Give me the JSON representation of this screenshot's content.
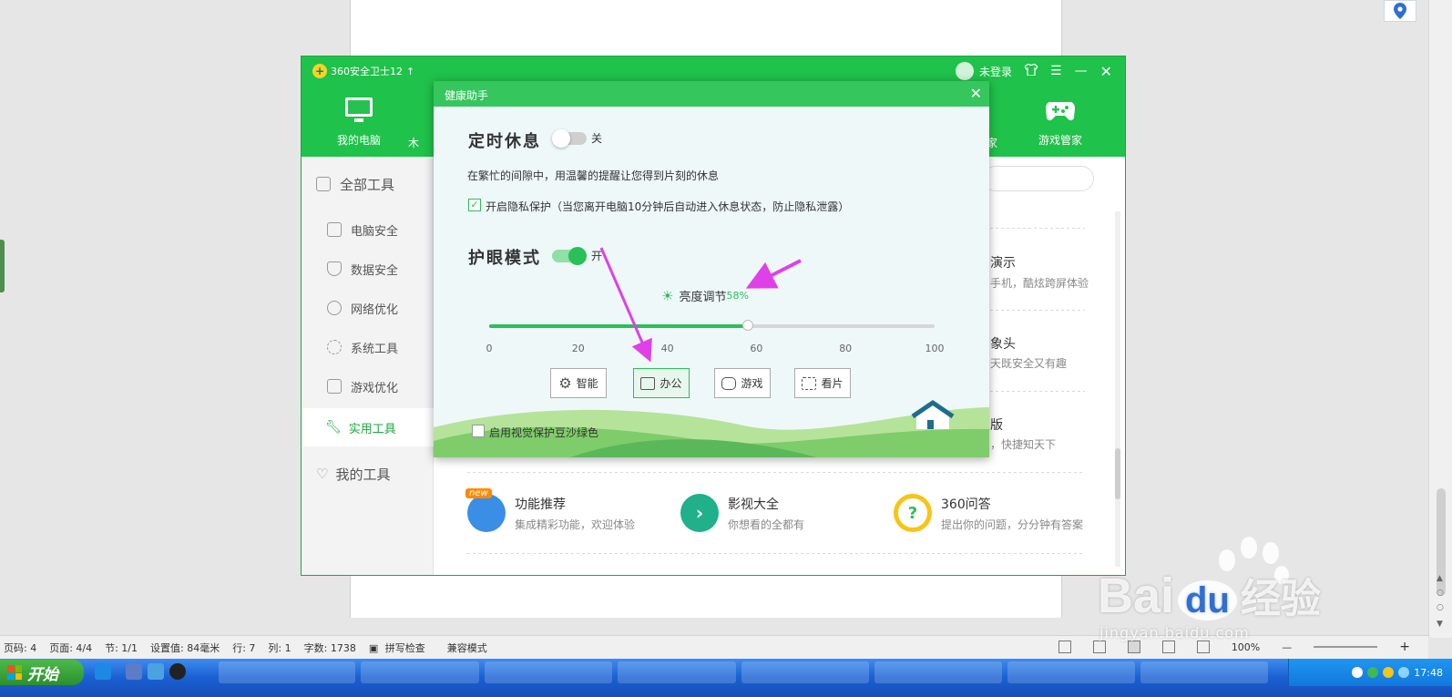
{
  "doc_status": {
    "page_code": "页码: 4",
    "pages": "页面: 4/4",
    "section": "节: 1/1",
    "setting": "设置值: 84毫米",
    "row": "行: 7",
    "col": "列: 1",
    "word_count": "字数: 1738",
    "spell_check": "拼写检查",
    "compat_mode": "兼容模式",
    "zoom": "100%"
  },
  "main_window": {
    "title": "360安全卫士12",
    "login": "未登录",
    "nav": [
      {
        "label": "我的电脑",
        "icon": "monitor-icon"
      },
      {
        "label": "木",
        "icon": "trojan-icon"
      },
      {
        "label": "家",
        "icon": "home-icon"
      },
      {
        "label": "游戏管家",
        "icon": "gamepad-icon"
      }
    ],
    "sidebar": {
      "all_tools": "全部工具",
      "items": [
        "电脑安全",
        "数据安全",
        "网络优化",
        "系统工具",
        "游戏优化",
        "实用工具"
      ],
      "my_tools": "我的工具",
      "active_index": 5
    },
    "partial_tools": [
      {
        "title": "演示",
        "desc": "手机，酷炫跨屏体验"
      },
      {
        "title": "象头",
        "desc": "天既安全又有趣"
      },
      {
        "title": "版",
        "desc": "，快捷知天下"
      }
    ],
    "tools": [
      {
        "title": "功能推荐",
        "desc": "集成精彩功能，欢迎体验",
        "badge": "new",
        "icon": "megaphone-icon",
        "color": "#3a8ee6"
      },
      {
        "title": "影视大全",
        "desc": "你想看的全都有",
        "icon": "play-icon",
        "color": "#20b08a"
      },
      {
        "title": "360问答",
        "desc": "提出你的问题，分分钟有答案",
        "icon": "question-icon",
        "color": "#f5c518"
      }
    ]
  },
  "dialog": {
    "title": "健康助手",
    "rest": {
      "title": "定时休息",
      "toggle_label": "关",
      "toggle_on": false,
      "desc": "在繁忙的间隙中，用温馨的提醒让您得到片刻的休息",
      "privacy_label": "开启隐私保护（当您离开电脑10分钟后自动进入休息状态，防止隐私泄露）",
      "privacy_checked": true
    },
    "eye": {
      "title": "护眼模式",
      "toggle_label": "开",
      "toggle_on": true,
      "brightness_label": "亮度调节",
      "brightness_value": "58%",
      "brightness_fraction": 0.58,
      "ticks": [
        "0",
        "20",
        "40",
        "60",
        "80",
        "100"
      ],
      "modes": [
        {
          "label": "智能",
          "icon": "gear-icon"
        },
        {
          "label": "办公",
          "icon": "monitor-icon"
        },
        {
          "label": "游戏",
          "icon": "gamepad-icon"
        },
        {
          "label": "看片",
          "icon": "film-icon"
        }
      ],
      "selected_mode": 1,
      "green_label": "启用视觉保护豆沙绿色",
      "green_checked": false
    }
  },
  "taskbar": {
    "start": "开始",
    "clock": "17:48"
  },
  "watermark": {
    "brand": "Bai",
    "brand_cn": "经验",
    "url": "jingyan.baidu.com"
  },
  "colors": {
    "brand_green": "#1fc24a",
    "toggle_green": "#2bbf58",
    "annotation_arrow": "#e040e8"
  }
}
